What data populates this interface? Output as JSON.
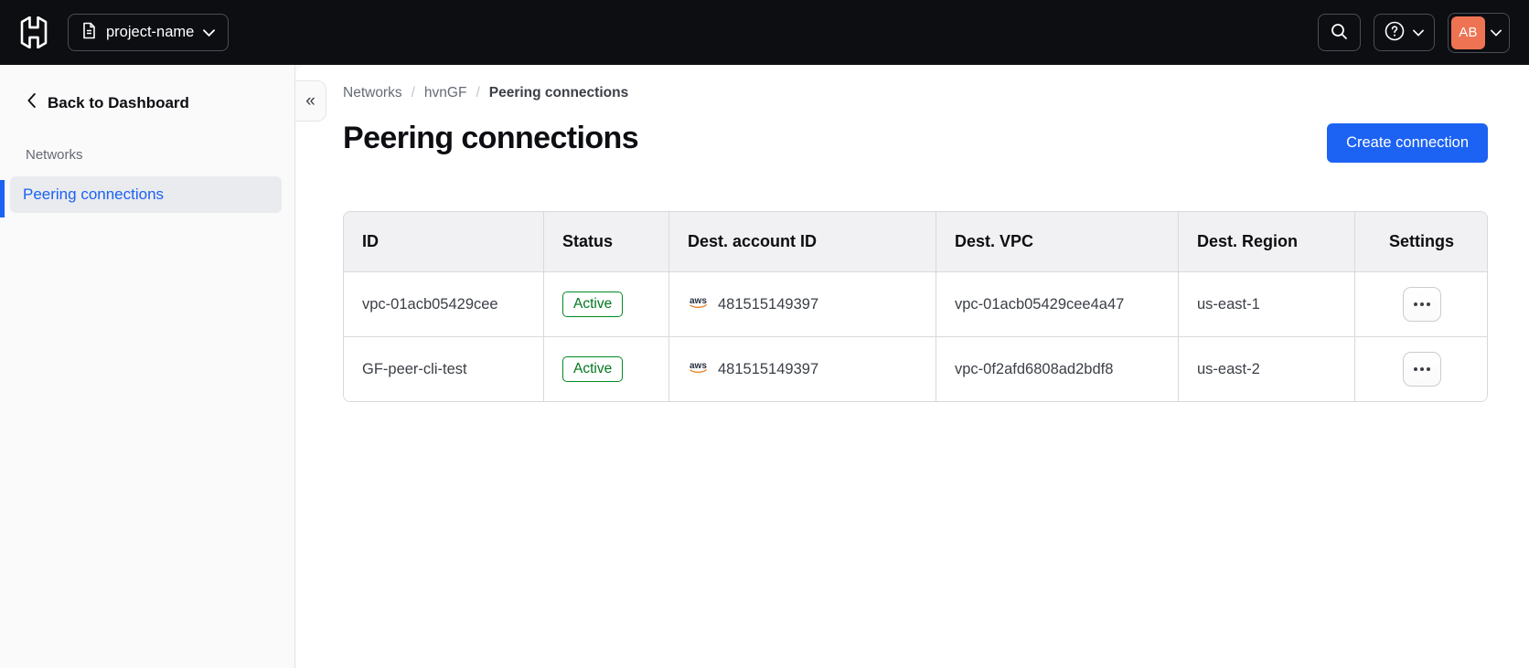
{
  "navbar": {
    "logo": "hashicorp-logo",
    "project_switcher": {
      "label": "project-name"
    },
    "avatar": {
      "initials": "AB"
    }
  },
  "sidebar": {
    "back_label": "Back to Dashboard",
    "section_label": "Networks",
    "active_item": "Peering connections",
    "collapse_icon": "«"
  },
  "breadcrumb": {
    "items": [
      "Networks",
      "hvnGF",
      "Peering connections"
    ],
    "separator": "/"
  },
  "page": {
    "title": "Peering connections",
    "create_button_label": "Create connection"
  },
  "table": {
    "columns": [
      "ID",
      "Status",
      "Dest. account ID",
      "Dest. VPC",
      "Dest. Region",
      "Settings"
    ],
    "rows": [
      {
        "id": "vpc-01acb05429cee",
        "status": "Active",
        "dest_account_id": "481515149397",
        "dest_vpc": "vpc-01acb05429cee4a47",
        "dest_region": "us-east-1"
      },
      {
        "id": "GF-peer-cli-test",
        "status": "Active",
        "dest_account_id": "481515149397",
        "dest_vpc": "vpc-0f2afd6808ad2bdf8",
        "dest_region": "us-east-2"
      }
    ]
  },
  "colors": {
    "accent-blue": "#1c62f3",
    "avatar-orange": "#ee7352",
    "badge-green": "#008a22",
    "badge-green-text": "#00781e",
    "navbar-bg": "#0d0e12"
  }
}
